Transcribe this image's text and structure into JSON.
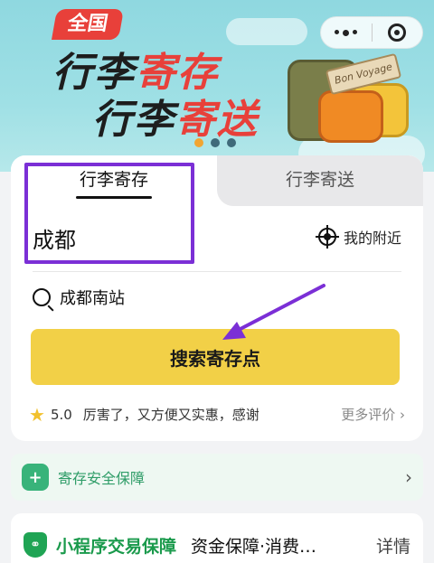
{
  "banner": {
    "badge": "全国",
    "line1_black": "行李",
    "line1_red": "寄存",
    "line2_black": "行李",
    "line2_red": "寄送",
    "tag_text": "Bon Voyage",
    "dots_count": 3,
    "active_dot": 0
  },
  "tabs": {
    "active": "行李寄存",
    "inactive": "行李寄送"
  },
  "location": {
    "city": "成都",
    "nearby_label": "我的附近"
  },
  "search": {
    "query": "成都南站",
    "button_label": "搜索寄存点"
  },
  "review": {
    "score": "5.0",
    "text": "厉害了，又方便又实惠，感谢",
    "more_label": "更多评价"
  },
  "safety": {
    "label": "寄存安全保障"
  },
  "trade": {
    "title": "小程序交易保障",
    "description": "资金保障·消费…",
    "detail": "详情"
  },
  "colors": {
    "accent_yellow": "#f2d047",
    "brand_red": "#e8403a",
    "highlight_purple": "#7b2fd6",
    "safety_green": "#2f9d68"
  }
}
